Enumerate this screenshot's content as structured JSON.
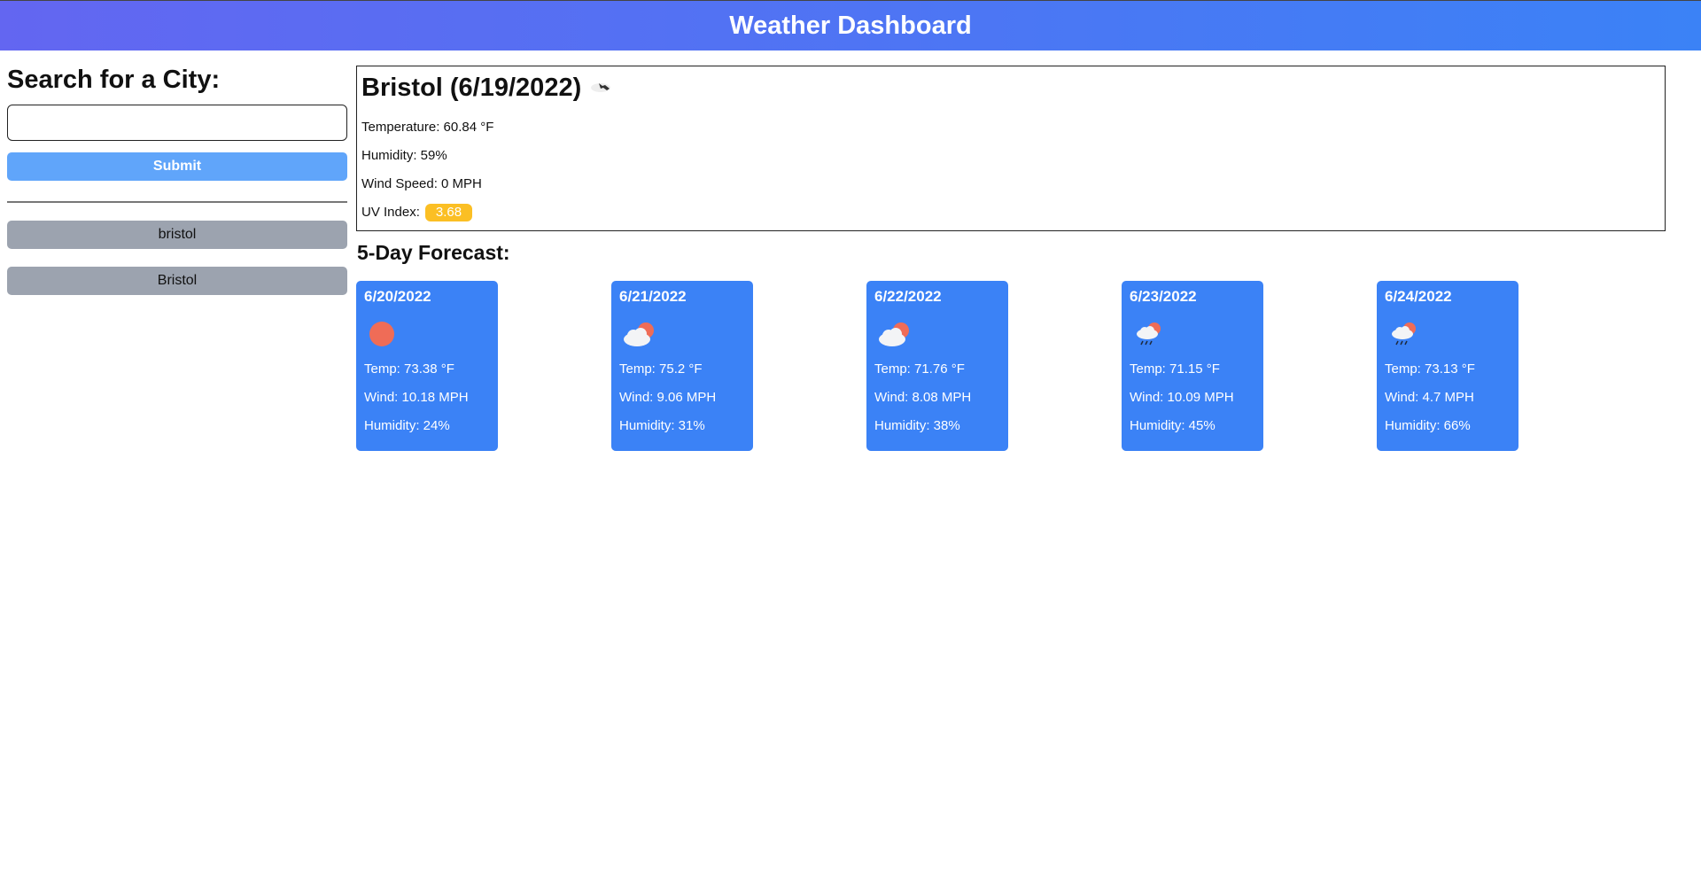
{
  "header": {
    "title": "Weather Dashboard"
  },
  "sidebar": {
    "heading": "Search for a City:",
    "search_value": "",
    "search_placeholder": "",
    "submit_label": "Submit",
    "history": [
      "bristol",
      "Bristol"
    ]
  },
  "current": {
    "title": "Bristol (6/19/2022)",
    "icon": "few-clouds-icon",
    "temperature": "Temperature: 60.84 °F",
    "humidity": "Humidity: 59%",
    "wind": "Wind Speed: 0 MPH",
    "uv_label": "UV Index:",
    "uv_value": "3.68",
    "uv_color": "#fbbf24"
  },
  "forecast": {
    "heading": "5-Day Forecast:",
    "days": [
      {
        "date": "6/20/2022",
        "icon": "sun-icon",
        "temp": "Temp: 73.38 °F",
        "wind": "Wind: 10.18 MPH",
        "humidity": "Humidity: 24%"
      },
      {
        "date": "6/21/2022",
        "icon": "partly-cloudy-icon",
        "temp": "Temp: 75.2 °F",
        "wind": "Wind: 9.06 MPH",
        "humidity": "Humidity: 31%"
      },
      {
        "date": "6/22/2022",
        "icon": "partly-cloudy-icon",
        "temp": "Temp: 71.76 °F",
        "wind": "Wind: 8.08 MPH",
        "humidity": "Humidity: 38%"
      },
      {
        "date": "6/23/2022",
        "icon": "rain-cloud-icon",
        "temp": "Temp: 71.15 °F",
        "wind": "Wind: 10.09 MPH",
        "humidity": "Humidity: 45%"
      },
      {
        "date": "6/24/2022",
        "icon": "rain-cloud-icon",
        "temp": "Temp: 73.13 °F",
        "wind": "Wind: 4.7 MPH",
        "humidity": "Humidity: 66%"
      }
    ]
  },
  "colors": {
    "header_start": "#6366f1",
    "header_end": "#3b82f6",
    "card": "#3b82f6",
    "submit": "#60a5fa",
    "history_button": "#9ca3af",
    "sun": "#ef6c57"
  }
}
